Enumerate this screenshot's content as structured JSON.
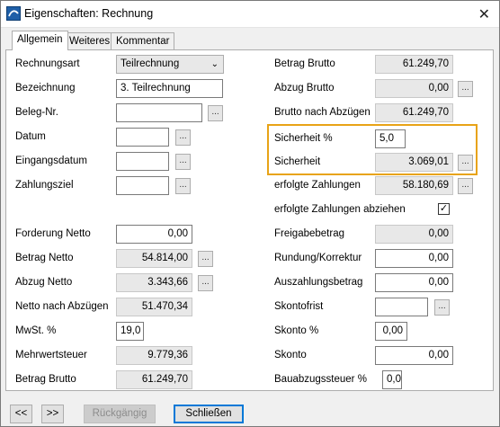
{
  "window": {
    "title": "Eigenschaften: Rechnung"
  },
  "tabs": [
    {
      "label": "Allgemein"
    },
    {
      "label": "Weiteres"
    },
    {
      "label": "Kommentar"
    }
  ],
  "left": {
    "rechnungsart": {
      "label": "Rechnungsart",
      "value": "Teilrechnung"
    },
    "bezeichnung": {
      "label": "Bezeichnung",
      "value": "3. Teilrechnung"
    },
    "beleg": {
      "label": "Beleg-Nr.",
      "value": ""
    },
    "datum": {
      "label": "Datum",
      "value": ""
    },
    "eingangsdatum": {
      "label": "Eingangsdatum",
      "value": ""
    },
    "zahlungsziel": {
      "label": "Zahlungsziel",
      "value": ""
    },
    "forderung_netto": {
      "label": "Forderung Netto",
      "value": "0,00"
    },
    "betrag_netto": {
      "label": "Betrag Netto",
      "value": "54.814,00"
    },
    "abzug_netto": {
      "label": "Abzug Netto",
      "value": "3.343,66"
    },
    "netto_nach_abzuegen": {
      "label": "Netto nach Abzügen",
      "value": "51.470,34"
    },
    "mwst": {
      "label": "MwSt. %",
      "value": "19,0"
    },
    "mehrwertsteuer": {
      "label": "Mehrwertsteuer",
      "value": "9.779,36"
    },
    "betrag_brutto": {
      "label": "Betrag Brutto",
      "value": "61.249,70"
    }
  },
  "right": {
    "betrag_brutto": {
      "label": "Betrag Brutto",
      "value": "61.249,70"
    },
    "abzug_brutto": {
      "label": "Abzug Brutto",
      "value": "0,00"
    },
    "brutto_nach_abzuegen": {
      "label": "Brutto nach Abzügen",
      "value": "61.249,70"
    },
    "sicherheit_pct": {
      "label": "Sicherheit %",
      "value": "5,0"
    },
    "sicherheit": {
      "label": "Sicherheit",
      "value": "3.069,01"
    },
    "erfolgte_zahlungen": {
      "label": "erfolgte Zahlungen",
      "value": "58.180,69"
    },
    "erfolgte_abziehen": {
      "label": "erfolgte Zahlungen abziehen",
      "checked": true,
      "mark": "✓"
    },
    "freigabebetrag": {
      "label": "Freigabebetrag",
      "value": "0,00"
    },
    "rundung": {
      "label": "Rundung/Korrektur",
      "value": "0,00"
    },
    "auszahlungsbetrag": {
      "label": "Auszahlungsbetrag",
      "value": "0,00"
    },
    "skontofrist": {
      "label": "Skontofrist",
      "value": ""
    },
    "skonto_pct": {
      "label": "Skonto %",
      "value": "0,00"
    },
    "skonto": {
      "label": "Skonto",
      "value": "0,00"
    },
    "bauabzugssteuer": {
      "label": "Bauabzugssteuer %",
      "value": "0,0"
    }
  },
  "buttons": {
    "prev": "<<",
    "next": ">>",
    "undo": "Rückgängig",
    "close": "Schließen",
    "dots": "..."
  },
  "colors": {
    "highlight": "#e8a317",
    "focus": "#0078d7"
  }
}
